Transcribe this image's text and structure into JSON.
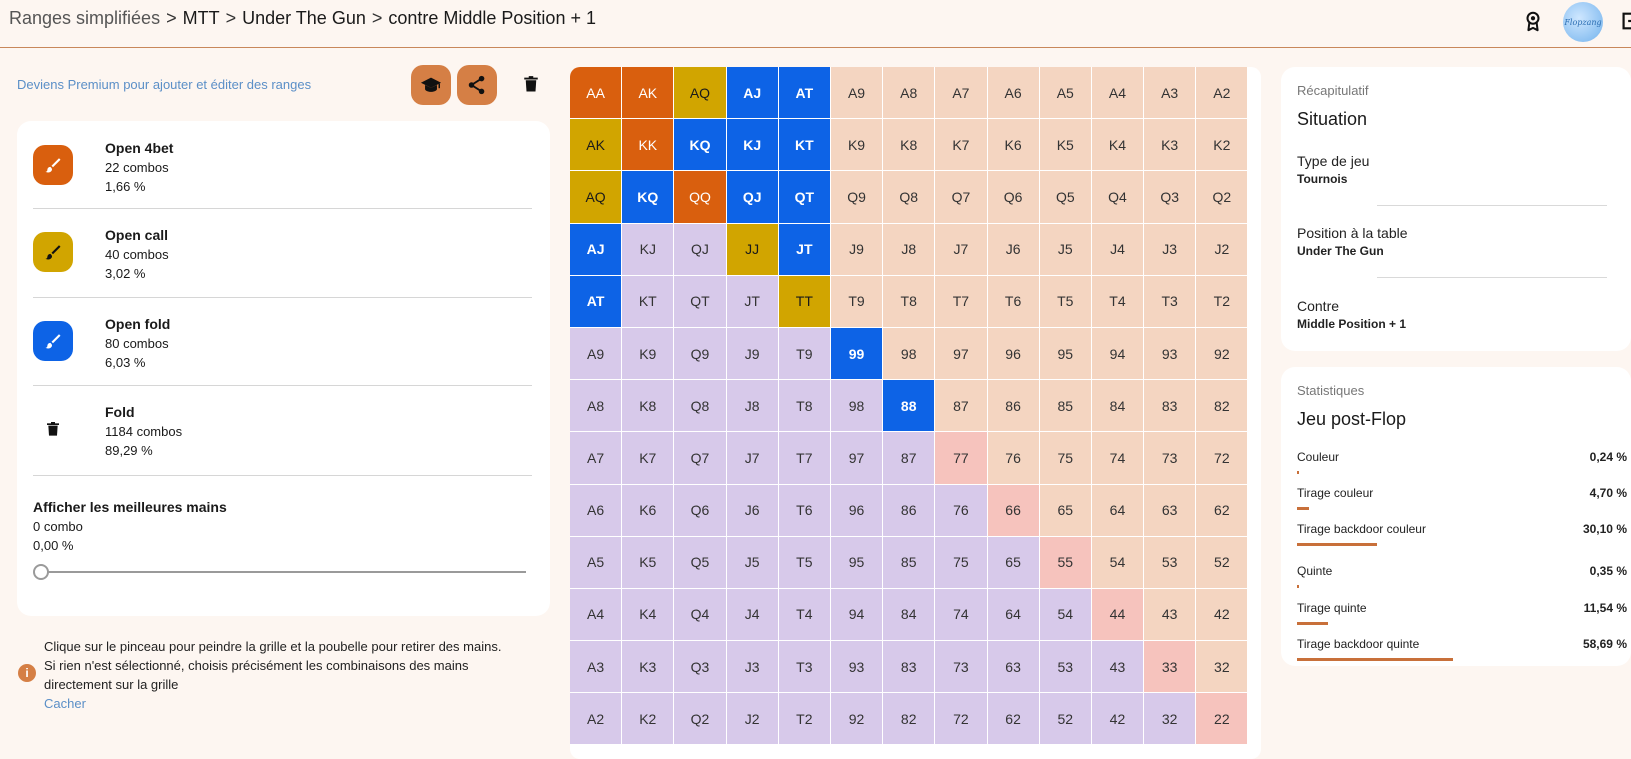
{
  "breadcrumb": {
    "root": "Ranges simplifiées",
    "separator": ">",
    "items": [
      "MTT",
      "Under The Gun",
      "contre Middle Position + 1"
    ]
  },
  "header_icons": [
    "award-icon",
    "avatar",
    "logout-icon"
  ],
  "avatar_text": "Flopzang",
  "premium_link": "Deviens Premium pour ajouter et éditer des ranges",
  "toolbar_icons": [
    "graduation-cap-icon",
    "share-icon",
    "trash-icon"
  ],
  "actions": [
    {
      "name": "Open 4bet",
      "combos": "22 combos",
      "percent": "1,66 %",
      "color": "#d95f0e",
      "icon": "brush-icon"
    },
    {
      "name": "Open call",
      "combos": "40 combos",
      "percent": "3,02 %",
      "color": "#d1a500",
      "icon": "brush-icon"
    },
    {
      "name": "Open fold",
      "combos": "80 combos",
      "percent": "6,03 %",
      "color": "#0d63e6",
      "icon": "brush-icon"
    },
    {
      "name": "Fold",
      "combos": "1184 combos",
      "percent": "89,29 %",
      "color": "#ffffff",
      "icon": "trash-icon"
    }
  ],
  "best_hands": {
    "label": "Afficher les meilleures mains",
    "combos": "0 combo",
    "percent": "0,00 %",
    "slider_value": 0
  },
  "info": {
    "line1": "Clique sur le pinceau pour peindre la grille et la poubelle pour retirer des mains.",
    "line2": "Si rien n'est sélectionné, choisis précisément les combinaisons des mains directement sur la grille",
    "hide": "Cacher"
  },
  "colors": {
    "accent": "#d57f45",
    "open_4bet": "#d95f0e",
    "open_call": "#d1a500",
    "open_fold": "#0d63e6",
    "offsuit": "#d7c9ea",
    "suited": "#f4d5c1",
    "pair": "#f6c3bd"
  },
  "grid": {
    "rows": [
      [
        "AA",
        "AK",
        "AQ",
        "AJ",
        "AT",
        "A9",
        "A8",
        "A7",
        "A6",
        "A5",
        "A4",
        "A3",
        "A2"
      ],
      [
        "AK",
        "KK",
        "KQ",
        "KJ",
        "KT",
        "K9",
        "K8",
        "K7",
        "K6",
        "K5",
        "K4",
        "K3",
        "K2"
      ],
      [
        "AQ",
        "KQ",
        "QQ",
        "QJ",
        "QT",
        "Q9",
        "Q8",
        "Q7",
        "Q6",
        "Q5",
        "Q4",
        "Q3",
        "Q2"
      ],
      [
        "AJ",
        "KJ",
        "QJ",
        "JJ",
        "JT",
        "J9",
        "J8",
        "J7",
        "J6",
        "J5",
        "J4",
        "J3",
        "J2"
      ],
      [
        "AT",
        "KT",
        "QT",
        "JT",
        "TT",
        "T9",
        "T8",
        "T7",
        "T6",
        "T5",
        "T4",
        "T3",
        "T2"
      ],
      [
        "A9",
        "K9",
        "Q9",
        "J9",
        "T9",
        "99",
        "98",
        "97",
        "96",
        "95",
        "94",
        "93",
        "92"
      ],
      [
        "A8",
        "K8",
        "Q8",
        "J8",
        "T8",
        "98",
        "88",
        "87",
        "86",
        "85",
        "84",
        "83",
        "82"
      ],
      [
        "A7",
        "K7",
        "Q7",
        "J7",
        "T7",
        "97",
        "87",
        "77",
        "76",
        "75",
        "74",
        "73",
        "72"
      ],
      [
        "A6",
        "K6",
        "Q6",
        "J6",
        "T6",
        "96",
        "86",
        "76",
        "66",
        "65",
        "64",
        "63",
        "62"
      ],
      [
        "A5",
        "K5",
        "Q5",
        "J5",
        "T5",
        "95",
        "85",
        "75",
        "65",
        "55",
        "54",
        "53",
        "52"
      ],
      [
        "A4",
        "K4",
        "Q4",
        "J4",
        "T4",
        "94",
        "84",
        "74",
        "64",
        "54",
        "44",
        "43",
        "42"
      ],
      [
        "A3",
        "K3",
        "Q3",
        "J3",
        "T3",
        "93",
        "83",
        "73",
        "63",
        "53",
        "43",
        "33",
        "32"
      ],
      [
        "A2",
        "K2",
        "Q2",
        "J2",
        "T2",
        "92",
        "82",
        "72",
        "62",
        "52",
        "42",
        "32",
        "22"
      ]
    ],
    "assignments": {
      "0,0": "4bet",
      "0,1": "4bet",
      "1,1": "4bet",
      "2,2": "4bet",
      "0,2": "call",
      "1,0": "call",
      "2,0": "call",
      "3,3": "call",
      "4,4": "call",
      "0,3": "fold",
      "0,4": "fold",
      "1,2": "fold",
      "1,3": "fold",
      "1,4": "fold",
      "2,1": "fold",
      "2,3": "fold",
      "2,4": "fold",
      "3,0": "fold",
      "3,4": "fold",
      "4,0": "fold",
      "5,5": "fold",
      "6,6": "fold"
    }
  },
  "summary": {
    "caption": "Récapitulatif",
    "title": "Situation",
    "fields": [
      {
        "label": "Type de jeu",
        "value": "Tournois"
      },
      {
        "label": "Position à la table",
        "value": "Under The Gun"
      },
      {
        "label": "Contre",
        "value": "Middle Position + 1"
      }
    ]
  },
  "stats": {
    "caption": "Statistiques",
    "title": "Jeu post-Flop",
    "items": [
      {
        "label": "Couleur",
        "value": "0,24 %",
        "fraction": 0.0024
      },
      {
        "label": "Tirage couleur",
        "value": "4,70 %",
        "fraction": 0.047
      },
      {
        "label": "Tirage backdoor couleur",
        "value": "30,10 %",
        "fraction": 0.301
      },
      {
        "label": "Quinte",
        "value": "0,35 %",
        "fraction": 0.0035
      },
      {
        "label": "Tirage quinte",
        "value": "11,54 %",
        "fraction": 0.1154
      },
      {
        "label": "Tirage backdoor quinte",
        "value": "58,69 %",
        "fraction": 0.5869
      }
    ]
  }
}
